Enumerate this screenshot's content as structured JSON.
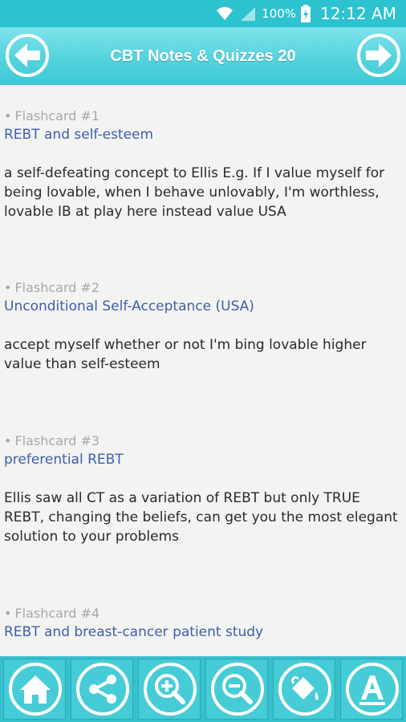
{
  "status_bar": {
    "battery": "100%",
    "time": "12:12 AM"
  },
  "app_bar": {
    "title": "CBT Notes & Quizzes 20"
  },
  "flashcards": [
    {
      "label": "Flashcard #1",
      "term": "REBT and self-esteem",
      "definition": "a self-defeating concept to Ellis E.g. If I value myself for being lovable, when I behave unlovably, I'm worthless, lovable IB at play here instead value USA"
    },
    {
      "label": "Flashcard #2",
      "term": "Unconditional Self-Acceptance (USA)",
      "definition": "accept myself whether or not I'm bing lovable higher value than self-esteem"
    },
    {
      "label": "Flashcard #3",
      "term": "preferential REBT",
      "definition": "Ellis saw all CT as a variation of REBT but only TRUE REBT, changing the beliefs, can get you the most elegant solution to your problems"
    },
    {
      "label": "Flashcard #4",
      "term": "REBT and breast-cancer patient study",
      "definition": ""
    }
  ],
  "toolbar": [
    "home-icon",
    "share-icon",
    "zoom-in-icon",
    "zoom-out-icon",
    "paint-bucket-icon",
    "font-icon"
  ],
  "colors": {
    "accent": "#2cc3cf",
    "term": "#3d5fae",
    "label": "#a8a8a8"
  }
}
